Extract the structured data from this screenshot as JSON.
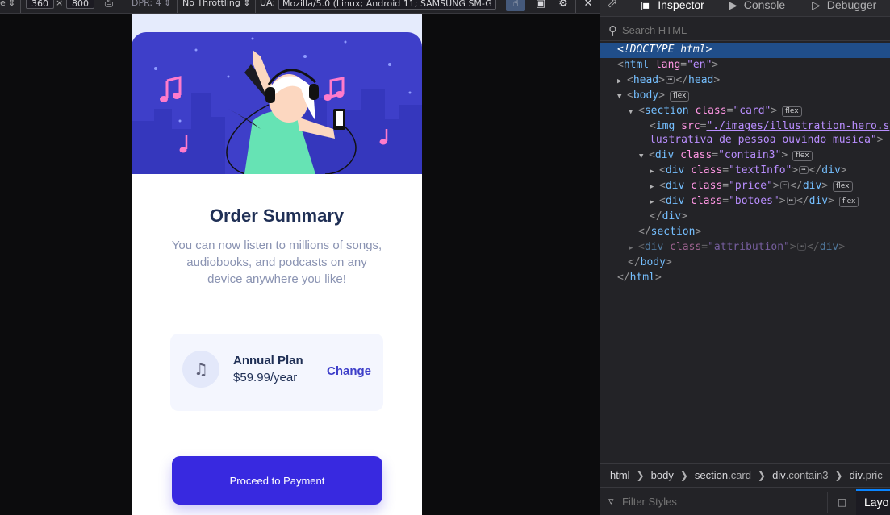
{
  "rdm_toolbar": {
    "device_suffix": "e ⇕",
    "width": "360",
    "times": "×",
    "height": "800",
    "dpr": "DPR: 4 ⇕",
    "throttling": "No Throttling ⇕",
    "ua_label": "UA:",
    "ua_value": "Mozilla/5.0 (Linux; Android 11; SAMSUNG SM-G",
    "close": "✕"
  },
  "card": {
    "title": "Order Summary",
    "description": "You can now listen to millions of songs, audiobooks, and podcasts on any device anywhere you like!",
    "plan_name": "Annual Plan",
    "plan_price": "$59.99/year",
    "change_label": "Change",
    "pay_label": "Proceed to Payment",
    "hero_alt": "ilustrativa de pessoa ouvindo musica"
  },
  "devtools": {
    "tabs": [
      {
        "label": "Inspector",
        "icon": "inspector-icon"
      },
      {
        "label": "Console",
        "icon": "console-icon"
      },
      {
        "label": "Debugger",
        "icon": "debugger-icon"
      }
    ],
    "search_placeholder": "Search HTML",
    "filter_placeholder": "Filter Styles",
    "layout_tab": "Layo",
    "breadcrumb": [
      "html",
      "body",
      "section",
      ".card",
      "div",
      ".contain3",
      "div",
      ".pric"
    ],
    "tree": {
      "doctype": "<!DOCTYPE html>",
      "html_tag": "html",
      "lang_attr": "lang",
      "lang_val": "\"en\"",
      "head_tag": "head",
      "body_tag": "body",
      "section_tag": "section",
      "class_attr": "class",
      "card_val": "\"card\"",
      "img_tag": "img",
      "src_attr": "src",
      "src_val": "\"./images/illustration-hero.s",
      "img_cont": "lustrativa de pessoa ouvindo musica\"",
      "div_tag": "div",
      "contain3_val": "\"contain3\"",
      "textinfo_val": "\"textInfo\"",
      "price_val": "\"price\"",
      "botoes_val": "\"botoes\"",
      "attribution_val": "\"attribution\"",
      "flex": "flex"
    }
  },
  "colors": {
    "brand_purple": "#3829e0",
    "hero_bg": "#3e3fc9",
    "page_bg": "#e5ebfc",
    "title": "#1f2f55",
    "devtools_bg": "#232327",
    "selected_row": "#204e8a"
  }
}
